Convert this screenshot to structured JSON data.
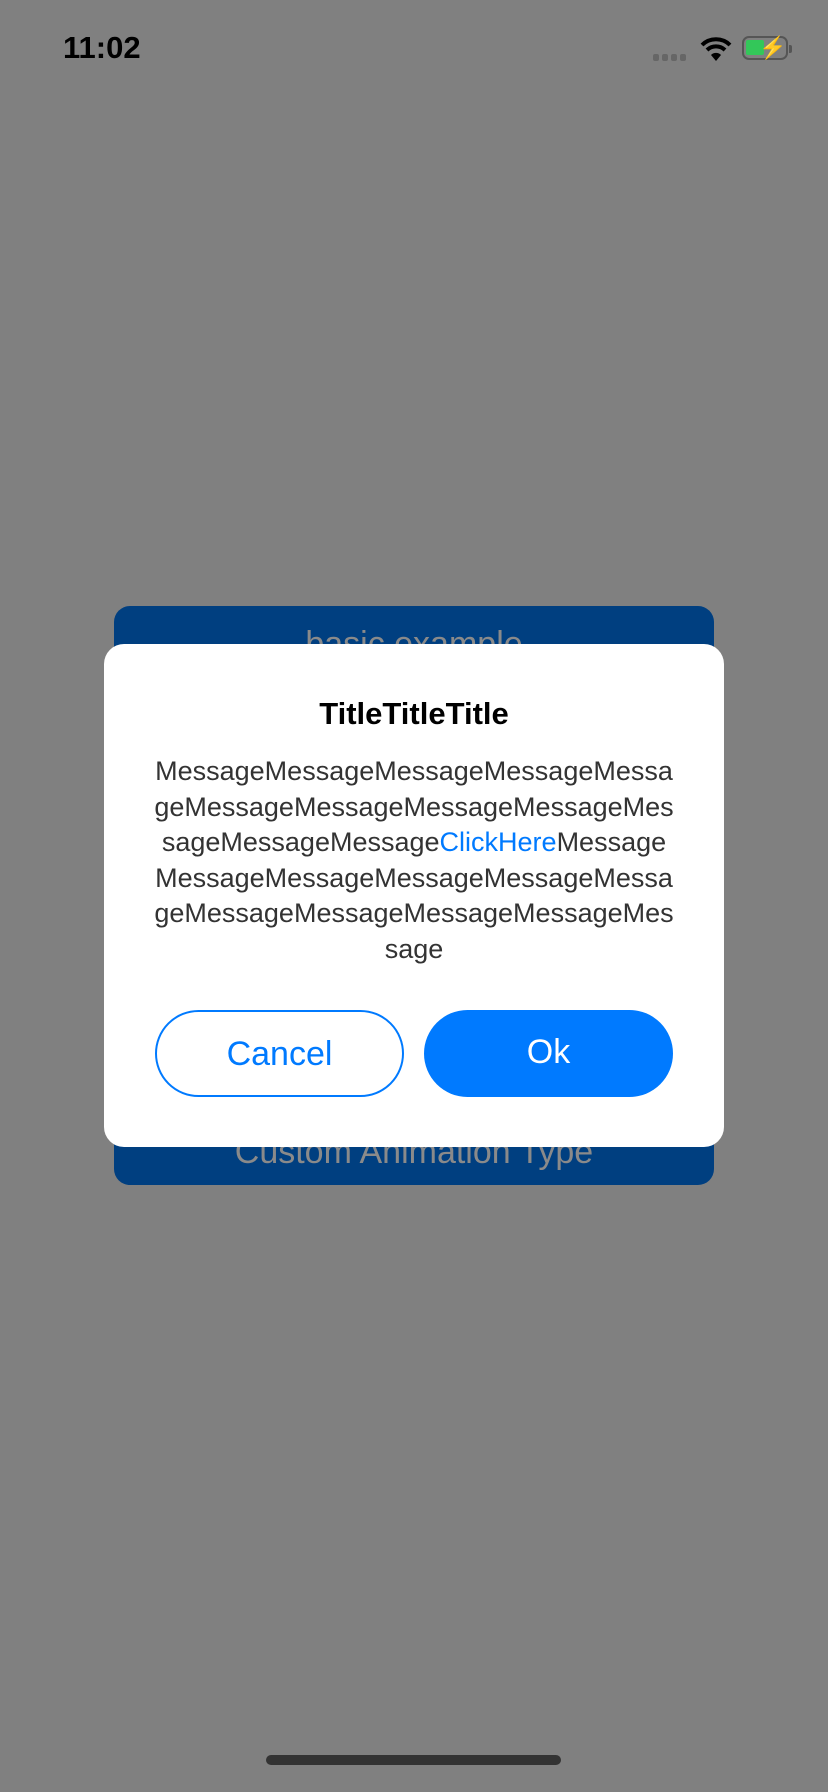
{
  "status_bar": {
    "time": "11:02",
    "icons": [
      "signal-icon",
      "wifi-icon",
      "battery-charging-icon"
    ],
    "battery_color": "#33c759"
  },
  "background": {
    "buttons": [
      {
        "label": "basic example"
      },
      {
        "label": "Custom Animation Type"
      }
    ],
    "button_color": "#003f80"
  },
  "dialog": {
    "title": "TitleTitleTitle",
    "message_before": "MessageMessageMessageMessageMessageMessageMessageMessageMessageMessageMessageMessage",
    "link": "ClickHere",
    "message_after": "MessageMessageMessageMessageMessageMessageMessageMessageMessageMessageMessage",
    "cancel_label": "Cancel",
    "ok_label": "Ok",
    "accent": "#007aff"
  }
}
